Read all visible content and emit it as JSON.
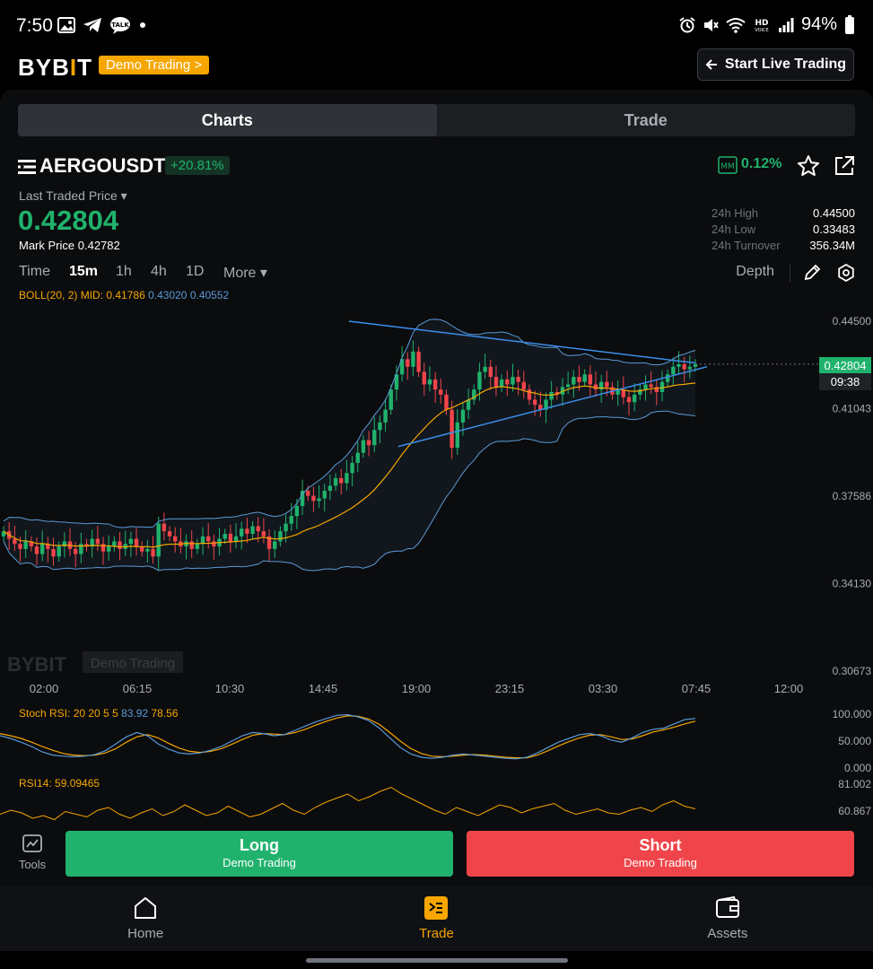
{
  "status_bar": {
    "time": "7:50",
    "talk": "TALK",
    "hd": "HD",
    "voice": "VOICE",
    "battery": "94%"
  },
  "brand": {
    "logo_left": "BYB",
    "logo_bar": "I",
    "logo_right": "T",
    "demo_badge": "Demo Trading >",
    "live_button": "Start Live Trading"
  },
  "tabs": [
    {
      "label": "Charts",
      "active": true
    },
    {
      "label": "Trade",
      "active": false
    }
  ],
  "symbol": {
    "name": "AERGOUSDT",
    "change": "+20.81%",
    "mm_label": "MM",
    "mm_value": "0.12%"
  },
  "price": {
    "label": "Last Traded Price ▾",
    "last": "0.42804",
    "mark_label": "Mark Price",
    "mark_value": "0.42782"
  },
  "stats": [
    {
      "label": "24h High",
      "value": "0.44500"
    },
    {
      "label": "24h Low",
      "value": "0.33483"
    },
    {
      "label": "24h Turnover",
      "value": "356.34M"
    }
  ],
  "timeframes": [
    "Time",
    "15m",
    "1h",
    "4h",
    "1D",
    "More ▾"
  ],
  "active_timeframe": "15m",
  "depth_label": "Depth",
  "boll": {
    "label": "BOLL(20, 2) MID: 0.41786",
    "upper": "0.43020",
    "lower": "0.40552"
  },
  "watermark": {
    "logo": "BYBIT",
    "badge": "Demo Trading"
  },
  "chart_data": {
    "type": "candlestick",
    "title": "",
    "price_ticks": [
      "0.44500",
      "0.41043",
      "0.37586",
      "0.34130",
      "0.30673"
    ],
    "price_range": [
      0.30673,
      0.445
    ],
    "time_ticks": [
      "02:00",
      "06:15",
      "10:30",
      "14:45",
      "19:00",
      "23:15",
      "03:30",
      "07:45",
      "12:00"
    ],
    "current_price": "0.42804",
    "countdown": "09:38",
    "close_series": [
      0.362,
      0.359,
      0.357,
      0.355,
      0.358,
      0.356,
      0.353,
      0.357,
      0.355,
      0.352,
      0.356,
      0.358,
      0.355,
      0.353,
      0.357,
      0.356,
      0.359,
      0.357,
      0.354,
      0.356,
      0.358,
      0.355,
      0.357,
      0.359,
      0.356,
      0.354,
      0.355,
      0.352,
      0.365,
      0.362,
      0.36,
      0.358,
      0.356,
      0.358,
      0.355,
      0.357,
      0.36,
      0.358,
      0.356,
      0.359,
      0.361,
      0.358,
      0.36,
      0.363,
      0.361,
      0.364,
      0.362,
      0.36,
      0.355,
      0.358,
      0.362,
      0.365,
      0.368,
      0.372,
      0.378,
      0.376,
      0.374,
      0.375,
      0.378,
      0.38,
      0.383,
      0.381,
      0.385,
      0.389,
      0.393,
      0.398,
      0.396,
      0.402,
      0.405,
      0.41,
      0.418,
      0.424,
      0.43,
      0.427,
      0.433,
      0.425,
      0.42,
      0.422,
      0.418,
      0.416,
      0.41,
      0.395,
      0.405,
      0.41,
      0.414,
      0.418,
      0.425,
      0.427,
      0.423,
      0.419,
      0.422,
      0.42,
      0.423,
      0.421,
      0.418,
      0.414,
      0.412,
      0.41,
      0.414,
      0.417,
      0.416,
      0.419,
      0.42,
      0.423,
      0.421,
      0.424,
      0.42,
      0.418,
      0.421,
      0.419,
      0.416,
      0.418,
      0.415,
      0.413,
      0.416,
      0.418,
      0.42,
      0.419,
      0.417,
      0.421,
      0.424,
      0.427,
      0.428,
      0.426,
      0.427,
      0.428
    ],
    "trendlines": "descending upper line and ascending lower line forming a symmetrical triangle"
  },
  "stoch_rsi": {
    "label": "Stoch RSI: 20 20 5 5",
    "k": "83.92",
    "d": "78.56",
    "ticks": [
      "100.000",
      "50.000",
      "0.000"
    ],
    "k_series": [
      60,
      55,
      48,
      40,
      30,
      24,
      22,
      21,
      22,
      25,
      32,
      45,
      58,
      66,
      60,
      45,
      35,
      28,
      26,
      28,
      33,
      40,
      50,
      60,
      66,
      64,
      60,
      62,
      70,
      78,
      86,
      92,
      98,
      99,
      95,
      88,
      74,
      56,
      38,
      26,
      20,
      18,
      20,
      24,
      26,
      24,
      22,
      20,
      18,
      17,
      20,
      28,
      38,
      48,
      55,
      62,
      64,
      60,
      52,
      48,
      56,
      66,
      72,
      74,
      82,
      90,
      92
    ],
    "d_series": [
      64,
      60,
      55,
      48,
      40,
      33,
      27,
      24,
      23,
      24,
      28,
      36,
      48,
      58,
      62,
      56,
      46,
      37,
      31,
      29,
      31,
      36,
      44,
      53,
      61,
      64,
      63,
      62,
      66,
      72,
      80,
      87,
      93,
      97,
      96,
      91,
      81,
      66,
      50,
      36,
      27,
      22,
      21,
      22,
      24,
      25,
      24,
      22,
      20,
      19,
      19,
      24,
      32,
      41,
      49,
      56,
      61,
      62,
      58,
      53,
      54,
      60,
      67,
      71,
      76,
      82,
      87
    ]
  },
  "rsi": {
    "label": "RSI14:",
    "value": "59.09465",
    "ticks": [
      "81.002",
      "60.867"
    ],
    "series": [
      55,
      58,
      56,
      52,
      54,
      51,
      57,
      55,
      53,
      58,
      60,
      55,
      52,
      56,
      59,
      54,
      57,
      62,
      58,
      54,
      56,
      61,
      57,
      53,
      55,
      59,
      63,
      58,
      55,
      60,
      64,
      67,
      70,
      65,
      68,
      72,
      75,
      70,
      66,
      62,
      58,
      55,
      60,
      57,
      54,
      58,
      62,
      60,
      56,
      59,
      61,
      63,
      58,
      55,
      57,
      59,
      56,
      55,
      58,
      60,
      57,
      62,
      65,
      61,
      59
    ]
  },
  "actions": {
    "tools": "Tools",
    "long": "Long",
    "long_sub": "Demo Trading",
    "short": "Short",
    "short_sub": "Demo Trading"
  },
  "nav": [
    {
      "label": "Home",
      "active": false
    },
    {
      "label": "Trade",
      "active": true
    },
    {
      "label": "Assets",
      "active": false
    }
  ],
  "colors": {
    "up": "#20b26c",
    "down": "#ef454a",
    "accent": "#f7a600",
    "boll_band": "#5b9ad6"
  }
}
